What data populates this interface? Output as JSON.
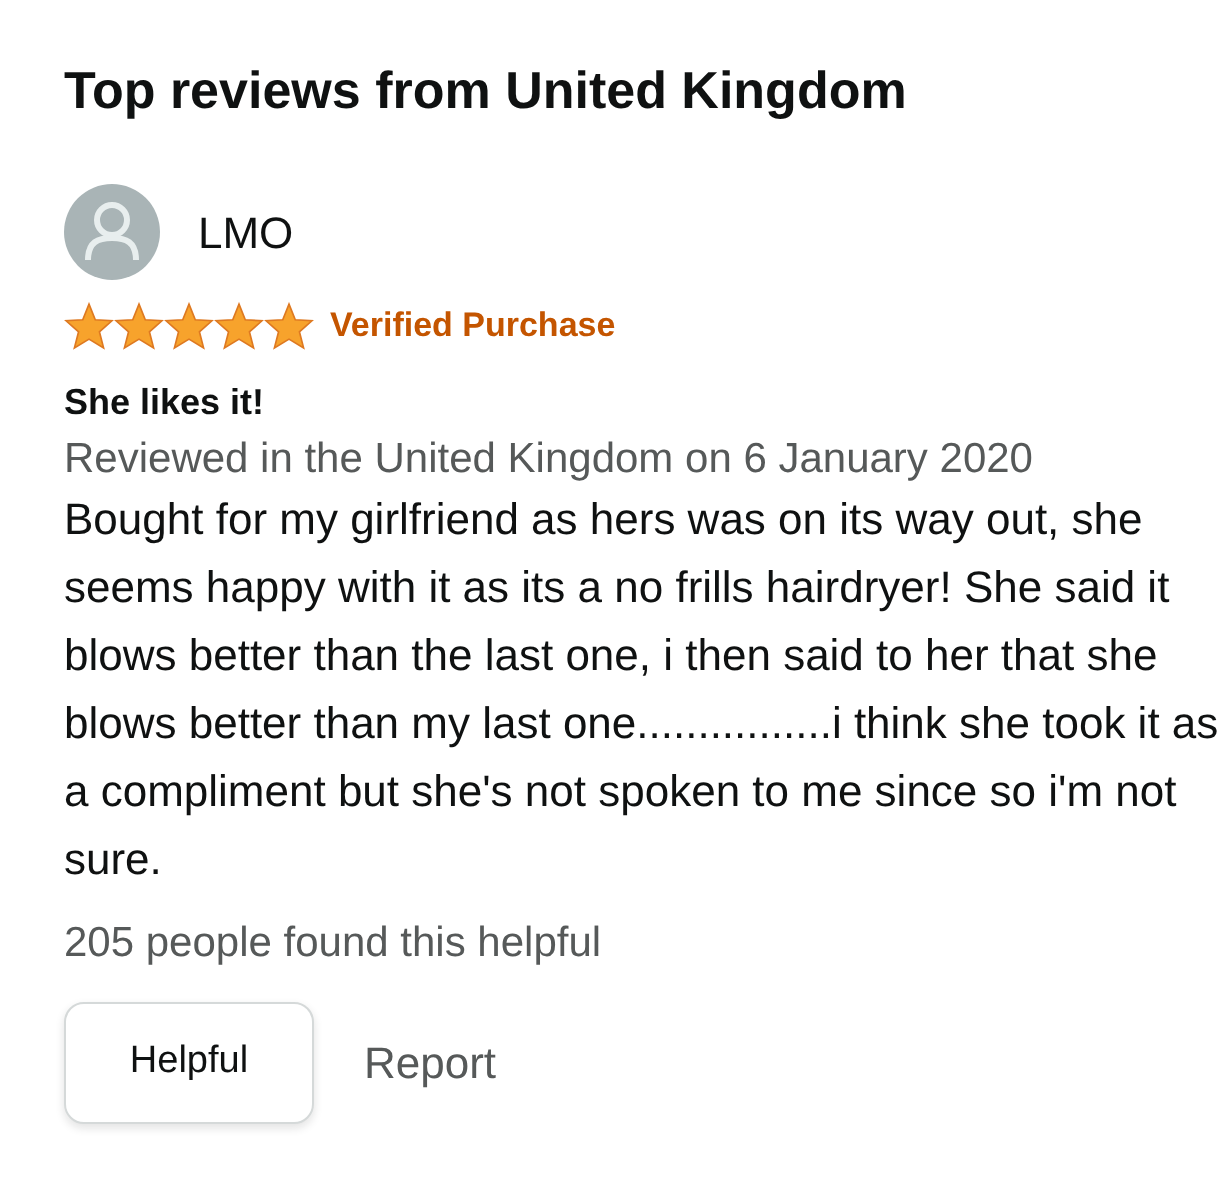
{
  "heading": "Top reviews from United Kingdom",
  "reviews": [
    {
      "author": "LMO",
      "stars": 5,
      "badge": "Verified Purchase",
      "title": "She likes it!",
      "meta": "Reviewed in the United Kingdom on 6 January 2020",
      "body": "Bought for my girlfriend as hers was on its way out, she seems happy with it as its a no frills hairdryer! She said it blows better than the last one, i then said to her that she blows better than my last one................i think she took it as a compliment but she's not spoken to me since so i'm not sure.",
      "helpful_count": "205 people found this helpful",
      "buttons": [
        "Helpful",
        "Report"
      ]
    }
  ]
}
